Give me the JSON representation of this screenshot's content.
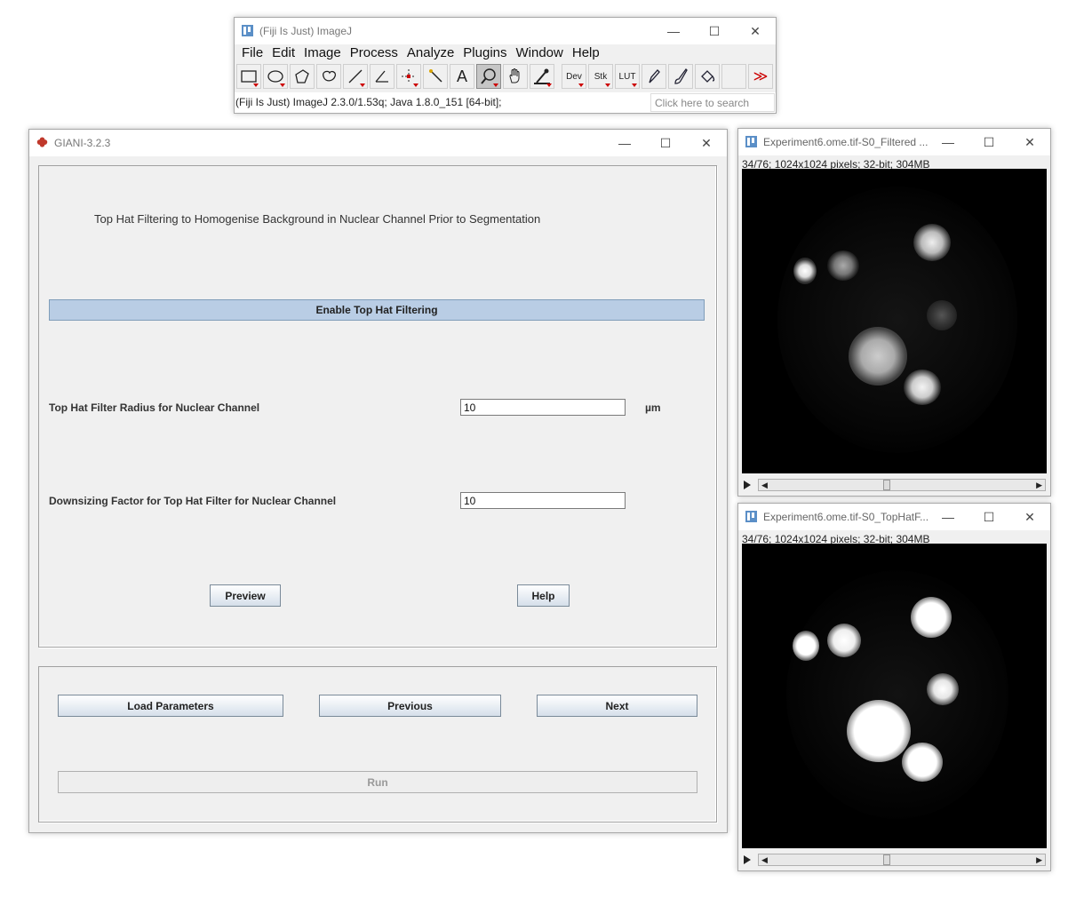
{
  "fiji": {
    "title": "(Fiji Is Just) ImageJ",
    "menu": [
      "File",
      "Edit",
      "Image",
      "Process",
      "Analyze",
      "Plugins",
      "Window",
      "Help"
    ],
    "tools": [
      "rectangle-icon",
      "oval-icon",
      "polygon-icon",
      "freehand-icon",
      "line-icon",
      "angle-icon",
      "point-icon",
      "wand-icon",
      "text-icon",
      "magnifier-icon",
      "hand-icon",
      "color-picker-icon",
      "Dev",
      "Stk",
      "LUT",
      "pencil-icon",
      "brush-icon",
      "flood-fill-icon",
      "blank",
      "more-tools-icon"
    ],
    "tool_labels": {
      "dev": "Dev",
      "stk": "Stk",
      "lut": "LUT",
      "text": "A",
      "more": "≫"
    },
    "status": "(Fiji Is Just) ImageJ 2.3.0/1.53q; Java 1.8.0_151 [64-bit];",
    "search_placeholder": "Click here to search"
  },
  "giani": {
    "title": "GIANI-3.2.3",
    "heading": "Top Hat Filtering to Homogenise Background in Nuclear Channel Prior to Segmentation",
    "enable_label": "Enable Top Hat Filtering",
    "radius_label": "Top Hat Filter Radius for Nuclear Channel",
    "radius_value": "10",
    "radius_unit": "µm",
    "downsize_label": "Downsizing Factor for Top Hat Filter for Nuclear Channel",
    "downsize_value": "10",
    "preview_label": "Preview",
    "help_label": "Help",
    "load_label": "Load Parameters",
    "previous_label": "Previous",
    "next_label": "Next",
    "run_label": "Run"
  },
  "image_windows": [
    {
      "title": "Experiment6.ome.tif-S0_Filtered ...",
      "info": "34/76; 1024x1024 pixels; 32-bit; 304MB"
    },
    {
      "title": "Experiment6.ome.tif-S0_TopHatF...",
      "info": "34/76; 1024x1024 pixels; 32-bit; 304MB"
    }
  ],
  "colors": {
    "accent_bar": "#b9cde5",
    "window_bg": "#f0f0f0",
    "canvas_bg": "#000000"
  }
}
